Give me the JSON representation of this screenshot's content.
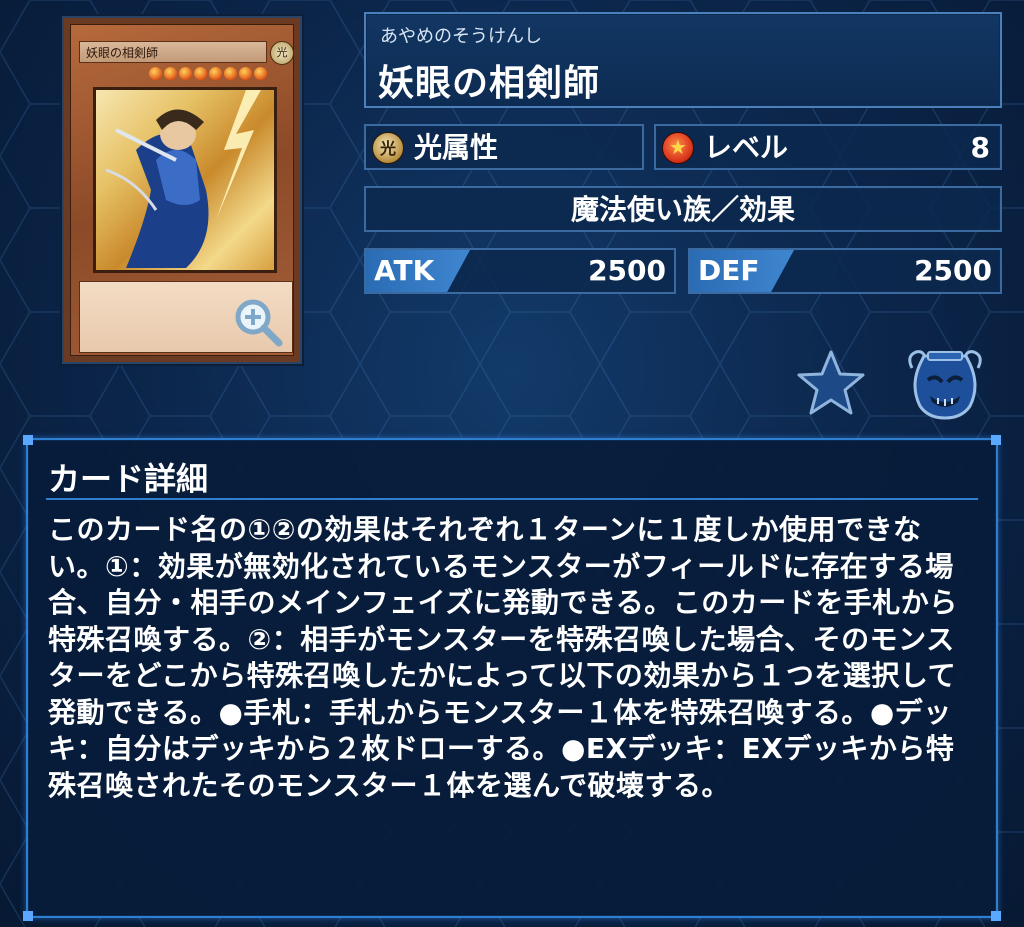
{
  "card": {
    "name_on_card": "妖眼の相剣師",
    "attribute_glyph": "光",
    "level_stars": 8,
    "zoom_icon": "magnifier-plus-icon"
  },
  "header": {
    "reading": "あやめのそうけんし",
    "name": "妖眼の相剣師"
  },
  "attribute": {
    "icon": "light-attribute-icon",
    "glyph": "光",
    "label": "光属性"
  },
  "level": {
    "icon": "level-star-icon",
    "label": "レベル",
    "value": "8"
  },
  "type": {
    "text": "魔法使い族／効果"
  },
  "stats": {
    "atk_label": "ATK",
    "atk_value": "2500",
    "def_label": "DEF",
    "def_value": "2500"
  },
  "actions": {
    "favorite_icon": "star-icon",
    "deck_icon": "pot-of-greed-icon"
  },
  "details": {
    "title": "カード詳細",
    "text": "このカード名の①②の効果はそれぞれ１ターンに１度しか使用できない。①：効果が無効化されているモンスターがフィールドに存在する場合、自分・相手のメインフェイズに発動できる。このカードを手札から特殊召喚する。②：相手がモンスターを特殊召喚した場合、そのモンスターをどこから特殊召喚したかによって以下の効果から１つを選択して発動できる。●手札：手札からモンスター１体を特殊召喚する。●デッキ：自分はデッキから２枚ドローする。●EXデッキ：EXデッキから特殊召喚されたそのモンスター１体を選んで破壊する。"
  },
  "colors": {
    "background": "#0b2448",
    "panel_border": "#3a6aa0",
    "accent": "#2f7fd0"
  }
}
